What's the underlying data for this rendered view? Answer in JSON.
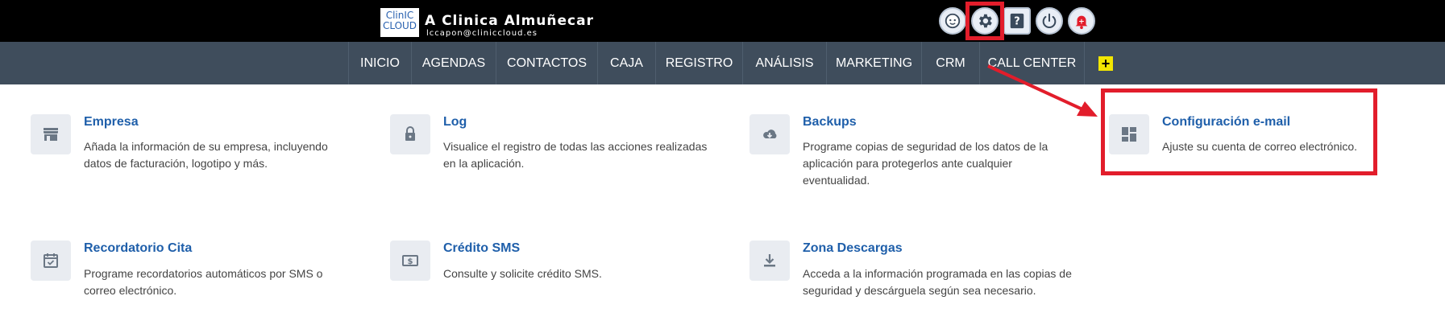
{
  "header": {
    "logo_line1": "ClinIC",
    "logo_line2": "CLOUD",
    "clinic_name": "A Clinica Almuñecar",
    "user_email": "lccapon@cliniccloud.es",
    "icons": [
      "user-face-icon",
      "gear-icon",
      "help-icon",
      "power-icon",
      "bell-icon"
    ]
  },
  "nav": {
    "items": [
      "INICIO",
      "AGENDAS",
      "CONTACTOS",
      "CAJA",
      "REGISTRO",
      "ANÁLISIS",
      "MARKETING",
      "CRM",
      "CALL CENTER"
    ],
    "plus_label": "+"
  },
  "cards": [
    {
      "title": "Empresa",
      "desc": "Añada la información de su empresa, incluyendo datos de facturación, logotipo y más.",
      "icon": "store-icon"
    },
    {
      "title": "Log",
      "desc": "Visualice el registro de todas las acciones realizadas en la aplicación.",
      "icon": "lock-icon"
    },
    {
      "title": "Backups",
      "desc": "Programe copias de seguridad de los datos de la aplicación para protegerlos ante cualquier eventualidad.",
      "icon": "cloud-download-icon"
    },
    {
      "title": "Configuración e-mail",
      "desc": "Ajuste su cuenta de correo electrónico.",
      "icon": "dashboard-icon"
    },
    {
      "title": "Recordatorio Cita",
      "desc": "Programe recordatorios automáticos por SMS o correo electrónico.",
      "icon": "calendar-check-icon"
    },
    {
      "title": "Crédito SMS",
      "desc": "Consulte y solicite crédito SMS.",
      "icon": "money-icon"
    },
    {
      "title": "Zona Descargas",
      "desc": "Acceda a la información programada en las copias de seguridad y descárguela según sea necesario.",
      "icon": "download-icon"
    }
  ],
  "colors": {
    "topbar": "#000000",
    "navbar": "#3f4d5c",
    "link": "#1f5faa",
    "annotation": "#e21d2b",
    "plus": "#f2e600"
  }
}
